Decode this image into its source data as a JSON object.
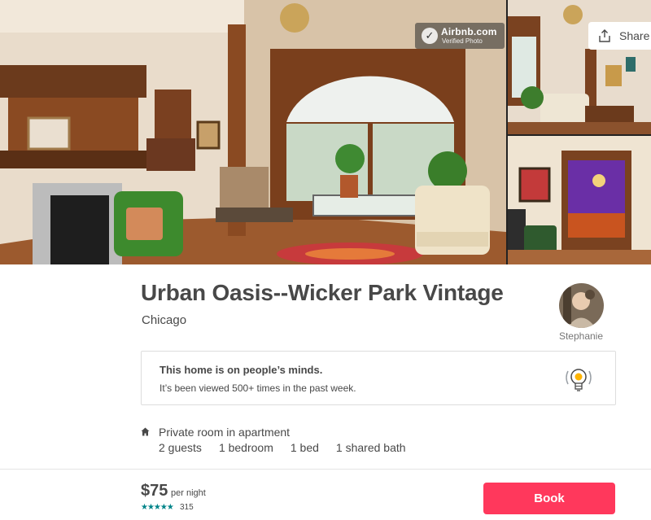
{
  "gallery": {
    "badge_brand": "Airbnb.com",
    "badge_sub": "Verified Photo",
    "share_label": "Share"
  },
  "listing": {
    "title": "Urban Oasis--Wicker Park Vintage",
    "location": "Chicago"
  },
  "host": {
    "name": "Stephanie"
  },
  "notice": {
    "title": "This home is on people’s minds.",
    "text": "It’s been viewed 500+ times in the past week."
  },
  "room": {
    "type": "Private room in apartment",
    "details": [
      "2 guests",
      "1 bedroom",
      "1 bed",
      "1 shared bath"
    ]
  },
  "booking": {
    "price": "$75",
    "per_night": "per night",
    "stars": "★★★★★",
    "review_count": "315",
    "book_label": "Book"
  },
  "colors": {
    "brand": "#ff385c",
    "text": "#484848",
    "teal": "#008489"
  },
  "icons": {
    "share": "share-icon",
    "bulb": "lightbulb-icon",
    "home": "home-icon",
    "verified": "checkmark-icon"
  }
}
